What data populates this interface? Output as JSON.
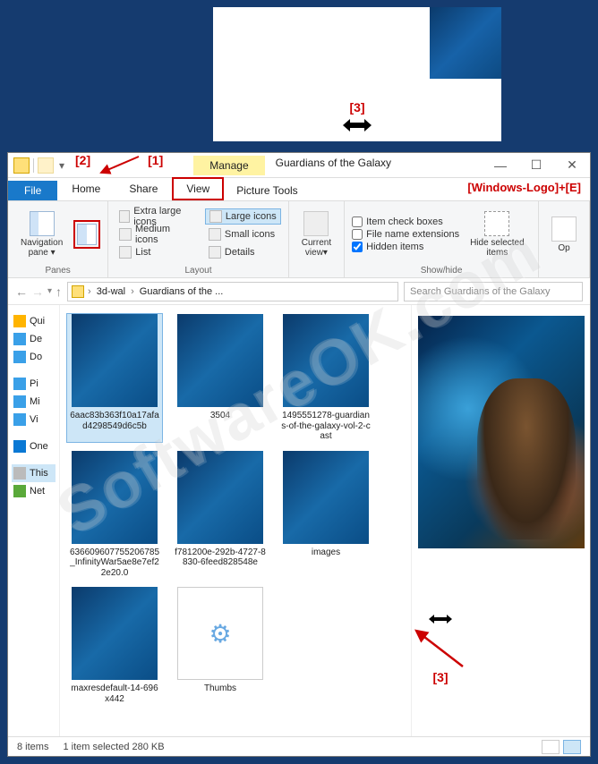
{
  "annotations": {
    "c1": "[1]",
    "c2": "[2]",
    "c3_top": "[3]",
    "c3_body": "[3]",
    "shortcut": "[Windows-Logo]+[E]"
  },
  "watermark": "SoftwareOK.com",
  "titlebar": {
    "ctx_label": "Manage",
    "title": "Guardians of the Galaxy",
    "min": "—",
    "max": "☐",
    "close": "✕"
  },
  "tabs": {
    "file": "File",
    "home": "Home",
    "share": "Share",
    "view": "View",
    "picture_tools": "Picture Tools"
  },
  "ribbon": {
    "panes": {
      "nav": "Navigation\npane ▾",
      "label": "Panes"
    },
    "layout": {
      "xl": "Extra large icons",
      "lg": "Large icons",
      "md": "Medium icons",
      "sm": "Small icons",
      "list": "List",
      "details": "Details",
      "label": "Layout"
    },
    "current_view": {
      "btn": "Current\nview▾"
    },
    "showhide": {
      "checkboxes": "Item check boxes",
      "ext": "File name extensions",
      "hidden": "Hidden items",
      "hide_btn": "Hide selected\nitems",
      "label": "Show/hide"
    },
    "options": "Op"
  },
  "address": {
    "seg1": "3d-wal",
    "seg2": "Guardians of the ...",
    "search_ph": "Search Guardians of the Galaxy"
  },
  "sidebar": {
    "quick": "Qui",
    "desktop": "De",
    "downloads": "Do",
    "pictures": "Pi",
    "music": "Mi",
    "videos": "Vi",
    "onedrive": "One",
    "thispc": "This",
    "network": "Net"
  },
  "files": [
    {
      "name": "6aac83b363f10a17afad4298549d6c5b",
      "type": "img",
      "sel": true
    },
    {
      "name": "3504",
      "type": "img"
    },
    {
      "name": "1495551278-guardians-of-the-galaxy-vol-2-cast",
      "type": "img"
    },
    {
      "name": "636609607755206785_InfinityWar5ae8e7ef22e20.0",
      "type": "img"
    },
    {
      "name": "f781200e-292b-4727-8830-6feed828548e",
      "type": "img"
    },
    {
      "name": "images",
      "type": "img"
    },
    {
      "name": "maxresdefault-14-696x442",
      "type": "img"
    },
    {
      "name": "Thumbs",
      "type": "doc"
    }
  ],
  "status": {
    "count": "8 items",
    "sel": "1 item selected  280 KB"
  }
}
